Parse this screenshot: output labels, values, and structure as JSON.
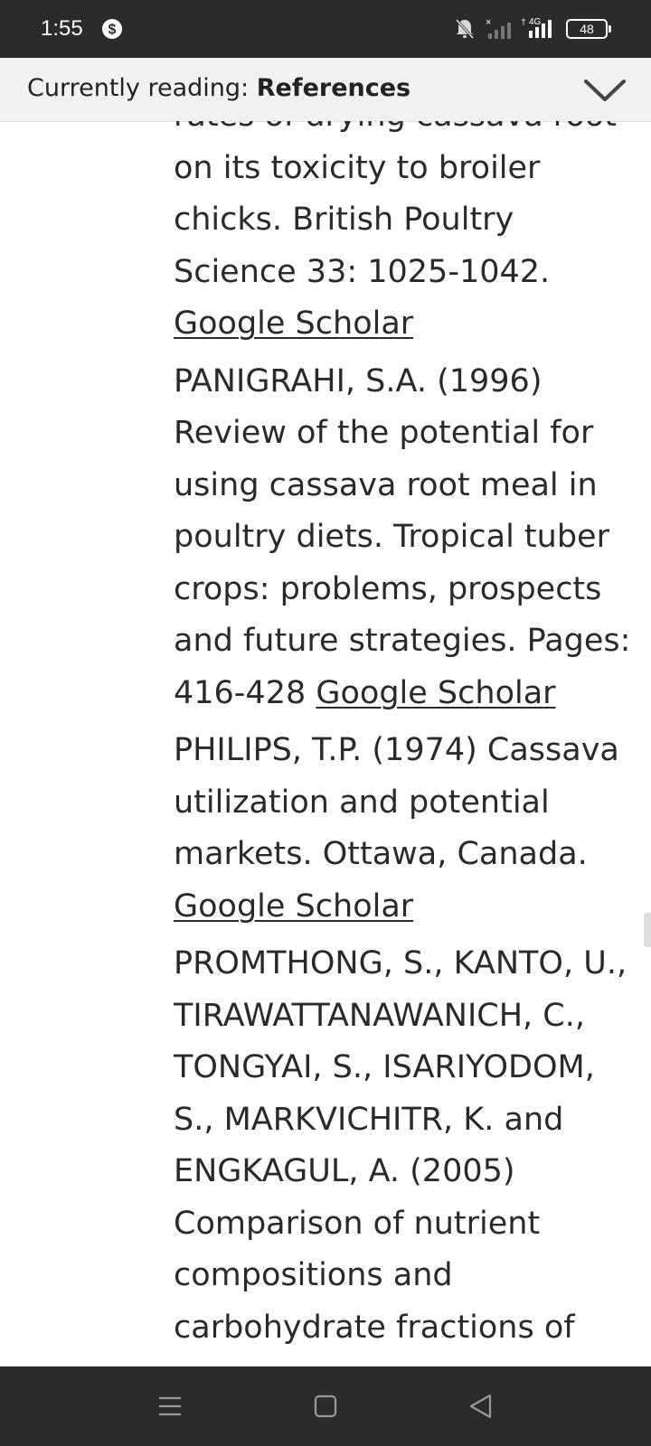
{
  "status_bar": {
    "time": "1:55",
    "app_icon": "dollar-circle-icon",
    "icons": [
      "bell-muted-icon",
      "signal-no-service-icon",
      "signal-4g-icon"
    ],
    "network_label": "4G",
    "battery_level": "48"
  },
  "reading_header": {
    "prefix": "Currently reading: ",
    "section": "References",
    "toggle_icon": "chevron-down-icon"
  },
  "references": [
    {
      "text": "rates of drying cassava root on its toxicity to broiler chicks. British Poultry Science 33: 1025-1042. ",
      "link": "Google Scholar"
    },
    {
      "text": "PANIGRAHI, S.A. (1996) Review of the potential for using cassava root meal in poultry diets. Tropical tuber crops: problems, prospects and future strategies. Pages: 416-428 ",
      "link": "Google Scholar"
    },
    {
      "text": "PHILIPS, T.P. (1974) Cassava utilization and potential markets. Ottawa, Canada. ",
      "link": "Google Scholar"
    },
    {
      "text": "PROMTHONG, S., KANTO, U., TIRAWATTANAWANICH, C., TONGYAI, S., ISARIYODOM, S., MARKVICHITR, K. and ENGKAGUL, A. (2005) Comparison of nutrient compositions and carbohydrate fractions of",
      "link": null
    }
  ],
  "nav_bar": {
    "buttons": [
      "menu-icon",
      "home-square-icon",
      "back-triangle-icon"
    ]
  }
}
